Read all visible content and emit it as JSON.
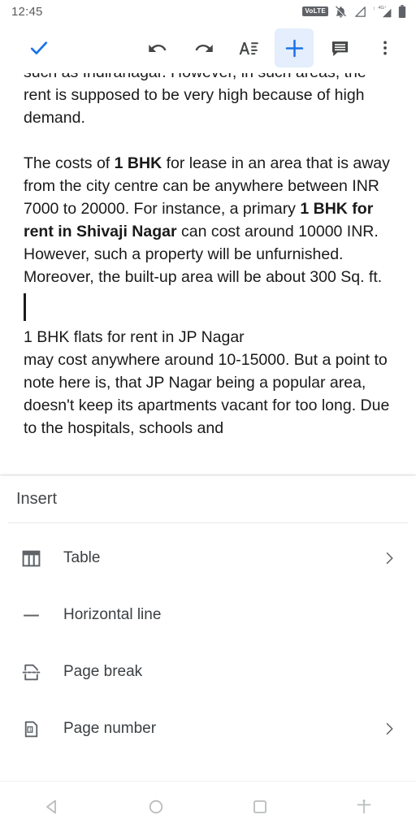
{
  "status_bar": {
    "time": "12:45",
    "icons": [
      {
        "name": "volte-icon",
        "label": "VoLTE"
      },
      {
        "name": "notifications-muted-icon",
        "label": ""
      },
      {
        "name": "signal-triangle-icon",
        "label": ""
      },
      {
        "name": "mobile-data-4g-plus-icon",
        "label": "4G+"
      },
      {
        "name": "battery-icon",
        "label": ""
      }
    ]
  },
  "toolbar": {
    "done_label": "done-check",
    "undo_label": "undo",
    "redo_label": "redo",
    "format_label": "format-text",
    "insert_label": "insert-plus",
    "comment_label": "comment",
    "more_label": "more-options",
    "active_item": "insert-plus",
    "accent_color": "#1a73e8",
    "active_background": "#e4eefc"
  },
  "document": {
    "clipped_top_line": "such as Indiranagar. However, in such areas, the",
    "paragraph_1": "rent is supposed to be very high because of high demand.",
    "paragraph_2_a": "The costs of ",
    "paragraph_2_b": "1 BHK",
    "paragraph_2_c": " for lease in an area that is away from the city centre can be anywhere between INR 7000 to 20000. For instance, a primary ",
    "paragraph_2_d": "1 BHK for rent in Shivaji Nagar",
    "paragraph_2_e": " can cost around 10000 INR. However, such a property will be unfurnished. Moreover, the built-up area will be about 300 Sq. ft.",
    "paragraph_3_line1": "1 BHK flats for rent in JP Nagar",
    "paragraph_3_line2": "may cost anywhere around 10-15000. But a point to note here is, that JP Nagar being a popular area, doesn't keep its apartments vacant for too long. Due to the hospitals, schools and",
    "text_color": "#1a1a1a"
  },
  "insert_sheet": {
    "title": "Insert",
    "items": [
      {
        "label": "Table",
        "icon": "table-icon",
        "has_chevron": true
      },
      {
        "label": "Horizontal line",
        "icon": "horizontal-line-icon",
        "has_chevron": false
      },
      {
        "label": "Page break",
        "icon": "page-break-icon",
        "has_chevron": false
      },
      {
        "label": "Page number",
        "icon": "page-number-icon",
        "has_chevron": true
      }
    ]
  },
  "nav_bar": {
    "back": "back-nav",
    "home": "home-nav",
    "recents": "recents-nav",
    "accessibility": "accessibility-nav"
  }
}
